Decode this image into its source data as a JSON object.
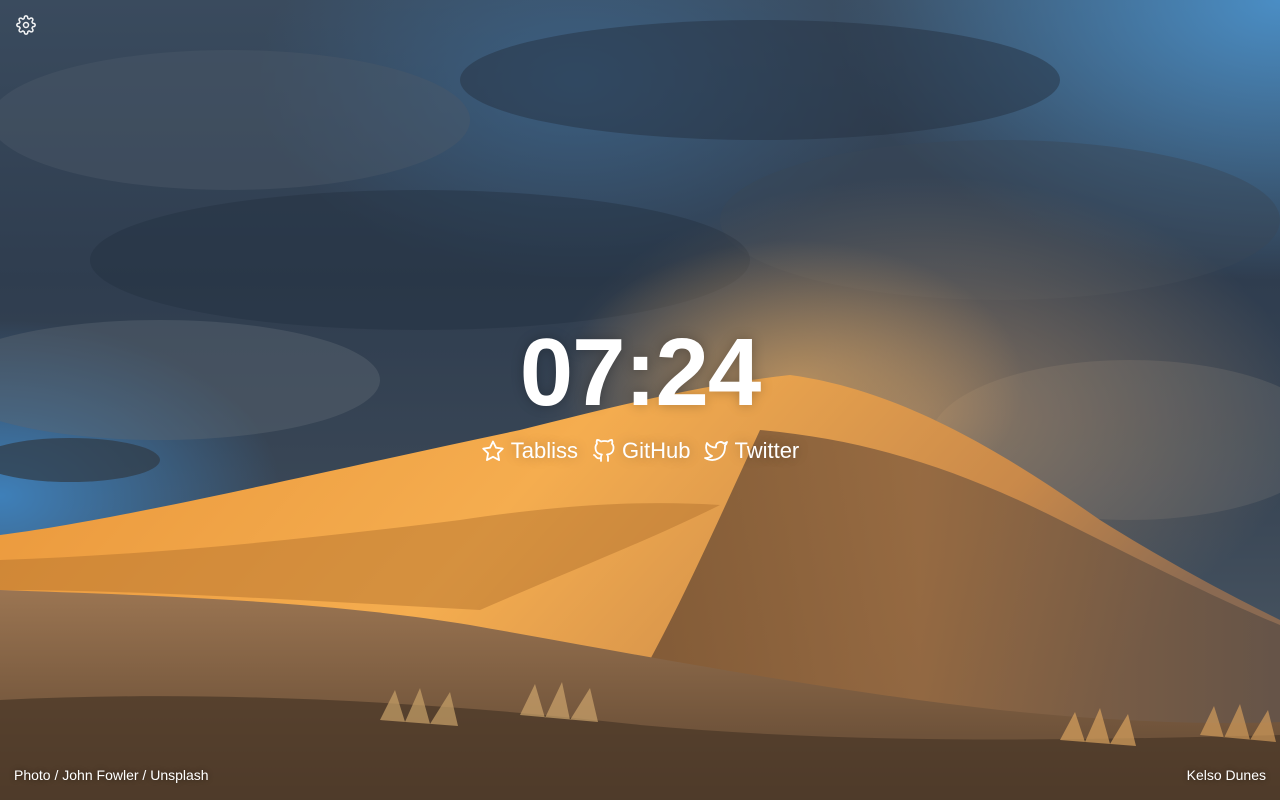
{
  "clock": {
    "time": "07:24"
  },
  "links": [
    {
      "label": "Tabliss",
      "icon": "star-icon"
    },
    {
      "label": "GitHub",
      "icon": "github-icon"
    },
    {
      "label": "Twitter",
      "icon": "twitter-icon"
    }
  ],
  "credit": {
    "prefix": "Photo",
    "separator": " / ",
    "photographer": "John Fowler",
    "source": "Unsplash"
  },
  "location": "Kelso Dunes",
  "settings": {
    "icon": "gear-icon"
  },
  "colors": {
    "text": "#ffffff",
    "sky_dark": "#2d3a4a",
    "sky_blue": "#3f7fb5",
    "dune_light": "#f0a440",
    "dune_shadow": "#7a5a3c"
  }
}
